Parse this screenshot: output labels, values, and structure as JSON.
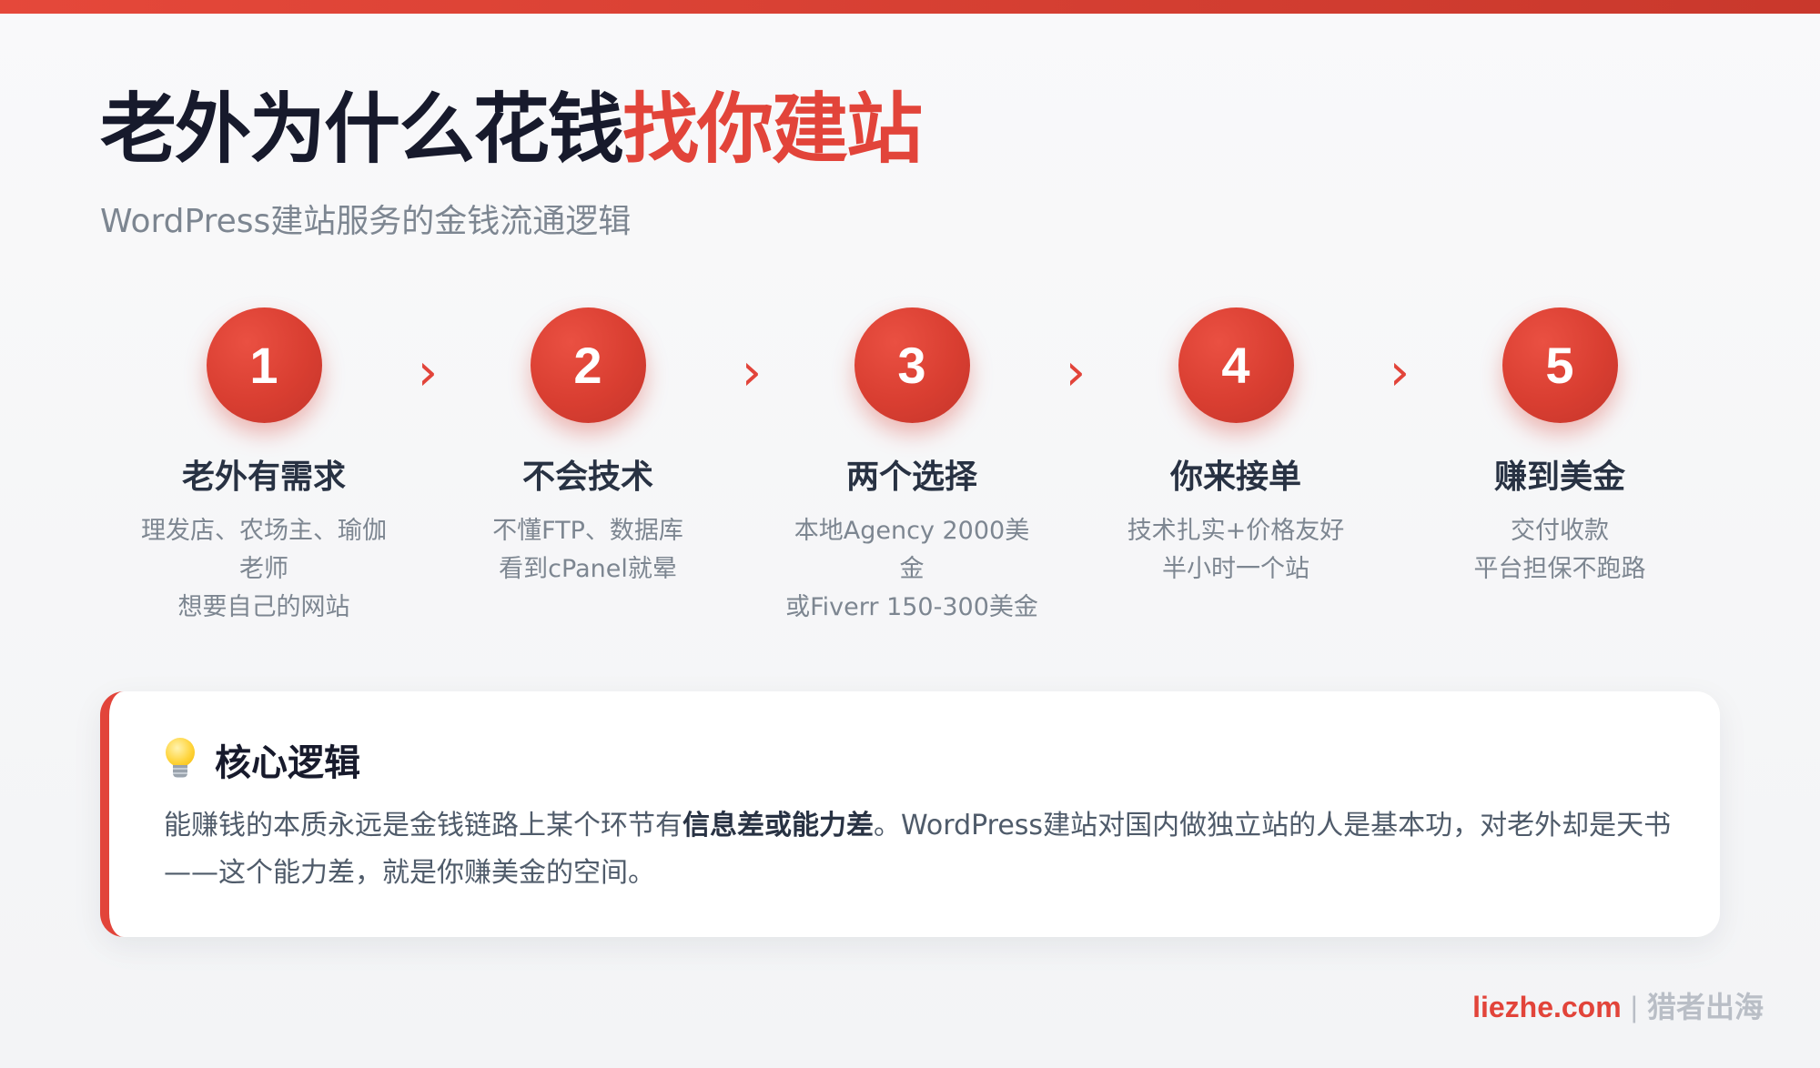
{
  "title": {
    "main": "老外为什么花钱",
    "accent": "找你建站"
  },
  "subtitle": "WordPress建站服务的金钱流通逻辑",
  "steps": [
    {
      "number": "1",
      "title": "老外有需求",
      "desc": [
        "理发店、农场主、瑜伽老师",
        "想要自己的网站"
      ]
    },
    {
      "number": "2",
      "title": "不会技术",
      "desc": [
        "不懂FTP、数据库",
        "看到cPanel就晕"
      ]
    },
    {
      "number": "3",
      "title": "两个选择",
      "desc": [
        "本地Agency 2000美金",
        "或Fiverr 150-300美金"
      ]
    },
    {
      "number": "4",
      "title": "你来接单",
      "desc": [
        "技术扎实+价格友好",
        "半小时一个站"
      ]
    },
    {
      "number": "5",
      "title": "赚到美金",
      "desc": [
        "交付收款",
        "平台担保不跑路"
      ]
    }
  ],
  "arrow_glyph": "›",
  "core": {
    "icon": "lightbulb-icon",
    "title": "核心逻辑",
    "text_before": "能赚钱的本质永远是金钱链路上某个环节有",
    "text_bold": "信息差或能力差",
    "text_after": "。WordPress建站对国内做独立站的人是基本功，对老外却是天书——这个能力差，就是你赚美金的空间。"
  },
  "footer": {
    "brand": "liezhe.com",
    "separator": "|",
    "name": "猎者出海"
  },
  "colors": {
    "accent": "#e2443a",
    "title": "#171a2c",
    "muted": "#7d8691"
  }
}
